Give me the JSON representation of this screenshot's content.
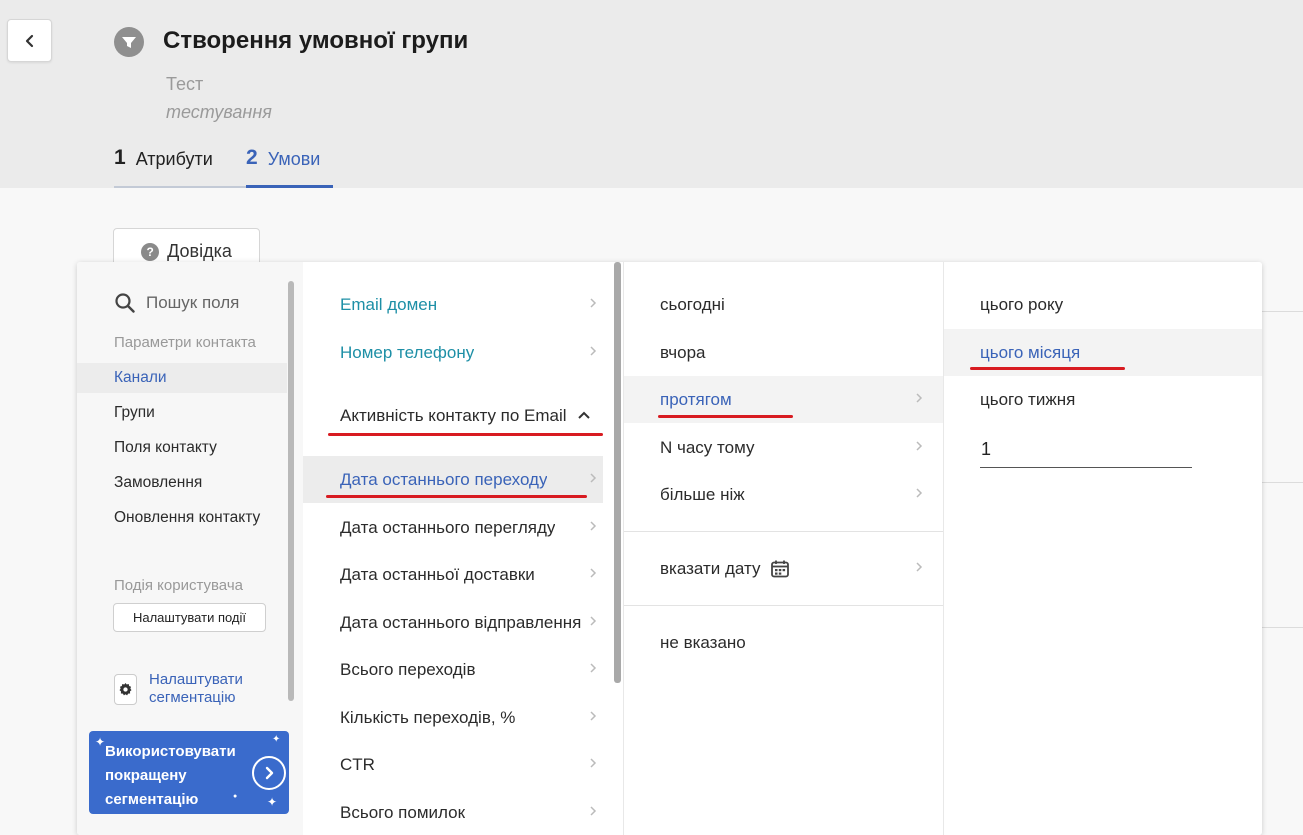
{
  "header": {
    "title": "Створення умовної групи",
    "subtitle": "Тест",
    "description": "тестування",
    "tabs": [
      {
        "num": "1",
        "label": "Атрибути"
      },
      {
        "num": "2",
        "label": "Умови"
      }
    ]
  },
  "help_button": "Довідка",
  "sidebar": {
    "search_placeholder": "Пошук поля",
    "section_contact": "Параметри контакта",
    "items": [
      "Канали",
      "Групи",
      "Поля контакту",
      "Замовлення",
      "Оновлення контакту"
    ],
    "active_item": "Канали",
    "section_user_event": "Подія користувача",
    "configure_events": "Налаштувати події",
    "configure_segmentation_line1": "Налаштувати",
    "configure_segmentation_line2": "сегментацію",
    "promo_line1": "Використовувати",
    "promo_line2": "покращену",
    "promo_line3": "сегментацію"
  },
  "fields": {
    "email_domain": "Email домен",
    "phone_number": "Номер телефону",
    "group_header": "Активність контакту по Email",
    "items": [
      "Дата останнього переходу",
      "Дата останнього перегляду",
      "Дата останньої доставки",
      "Дата останнього відправлення",
      "Всього переходів",
      "Кількість переходів, %",
      "CTR",
      "Всього помилок"
    ],
    "selected_item": "Дата останнього переходу"
  },
  "periods": {
    "items": [
      "сьогодні",
      "вчора",
      "протягом",
      "N часу тому",
      "більше ніж"
    ],
    "selected_item": "протягом",
    "specify_date": "вказати дату",
    "not_specified": "не вказано"
  },
  "within": {
    "items": [
      "цього року",
      "цього місяця",
      "цього тижня"
    ],
    "selected_item": "цього місяця",
    "number_value": "1"
  },
  "colors": {
    "accent": "#3a63b8",
    "teal": "#1d8fa6",
    "promo": "#3a6bcc",
    "annotation": "#d81b21"
  }
}
